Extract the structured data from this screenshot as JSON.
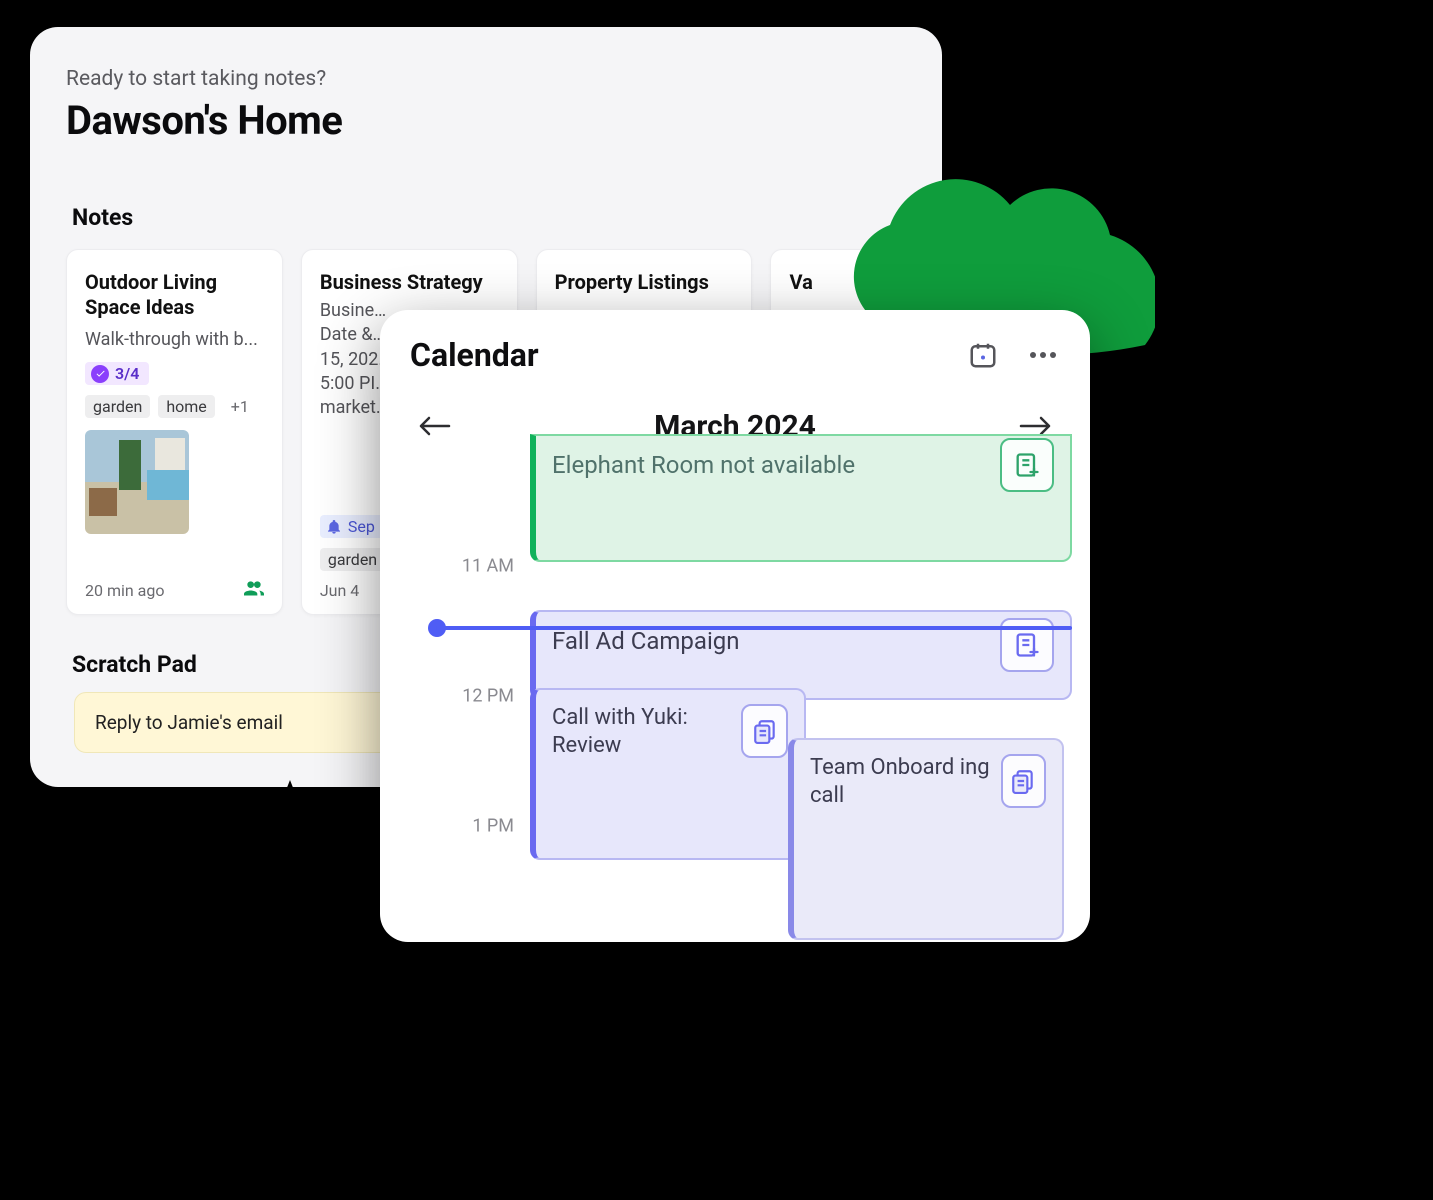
{
  "home": {
    "subhead": "Ready to start taking notes?",
    "title": "Dawson's Home",
    "notes_heading": "Notes",
    "notes": [
      {
        "title": "Outdoor Living Space Ideas",
        "body": "Walk-through with b...",
        "tasks_badge": "3/4",
        "tags": [
          "garden",
          "home"
        ],
        "more_tags": "+1",
        "meta": "20 min ago",
        "shared": true,
        "thumbnail": true
      },
      {
        "title": "Business Strategy",
        "body": "Busine…\nDate &…\n15, 202…\n5:00 PI…\nmarket…",
        "reminder": "Sep",
        "tags": [
          "garden"
        ],
        "meta": "Jun 4"
      },
      {
        "title": "Property Listings"
      },
      {
        "title": "Va"
      }
    ],
    "scratch_heading": "Scratch Pad",
    "scratch_text": "Reply to Jamie's email"
  },
  "calendar": {
    "title": "Calendar",
    "month": "March 2024",
    "time_labels": {
      "t11": "11 AM",
      "t12": "12 PM",
      "t13": "1 PM"
    },
    "events": {
      "elephant": "Elephant Room not available",
      "fall": "Fall Ad Campaign",
      "yuki": "Call with Yuki: Review",
      "onboard": "Team Onboard ing call"
    }
  }
}
